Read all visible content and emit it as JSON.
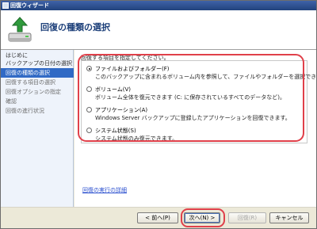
{
  "window": {
    "title": "回復ウィザード"
  },
  "header": {
    "title": "回復の種類の選択"
  },
  "sidebar": {
    "items": [
      {
        "label": "はじめに"
      },
      {
        "label": "バックアップの日付の選択"
      },
      {
        "label": "回復の種類の選択"
      },
      {
        "label": "回復する項目の選択"
      },
      {
        "label": "回復オプションの指定"
      },
      {
        "label": "確認"
      },
      {
        "label": "回復の進行状況"
      }
    ]
  },
  "main": {
    "prompt": "回復する項目を指定してください。",
    "options": [
      {
        "label": "ファイルおよびフォルダー(F)",
        "description": "このバックアップに含まれるボリューム内を参照して、ファイルやフォルダーを選択できます。",
        "checked": true
      },
      {
        "label": "ボリューム(V)",
        "description": "ボリューム全体を復元できます (C: に保存されているすべてのデータなど)。",
        "checked": false
      },
      {
        "label": "アプリケーション(A)",
        "description": "Windows Server バックアップに登録したアプリケーションを回復できます。",
        "checked": false
      },
      {
        "label": "システム状態(S)",
        "description": "システム状態のみ復元できます。",
        "checked": false
      }
    ],
    "help_link": "回復の実行の詳細"
  },
  "footer": {
    "back_label": "< 前へ(P)",
    "next_label": "次へ(N) >",
    "recover_label": "回復(R)",
    "cancel_label": "キャンセル"
  },
  "colors": {
    "accent": "#316ac5",
    "annotation": "#e0404a",
    "title_text": "#1c3f79",
    "link": "#2a4fcf"
  }
}
